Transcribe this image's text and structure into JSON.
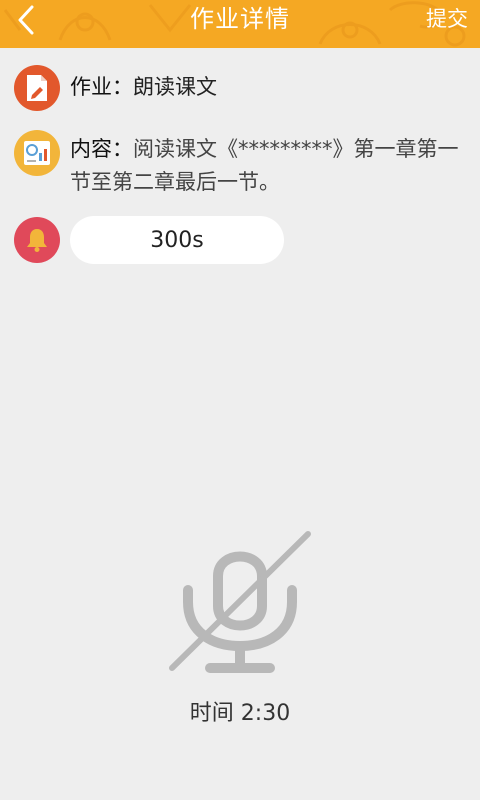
{
  "header": {
    "title": "作业详情",
    "submit_label": "提交",
    "back_icon": "chevron-left-icon",
    "background_color": "#f5a823"
  },
  "homework": {
    "label": "作业：",
    "value": "朗读课文",
    "icon": "document-edit-icon",
    "icon_color": "#e2582c"
  },
  "content": {
    "label": "内容：",
    "value": "阅读课文《*********》第一章第一节至第二章最后一节。",
    "icon": "chart-report-icon",
    "icon_color": "#f2b53a"
  },
  "duration": {
    "value": "300s",
    "icon": "bell-icon",
    "icon_color": "#e0495a"
  },
  "recorder": {
    "icon": "microphone-muted-icon",
    "timer_text": "时间 2:30"
  }
}
